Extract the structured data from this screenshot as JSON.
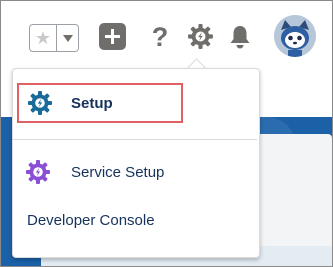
{
  "toolbar": {
    "favorites": {
      "star_icon": "star-icon",
      "caret_icon": "caret-down-icon"
    },
    "add_icon": "plus-icon",
    "help_label": "?",
    "setup_icon": "gear-icon",
    "notifications_icon": "bell-icon",
    "avatar_icon": "astro-avatar"
  },
  "menu": {
    "items": [
      {
        "label": "Setup",
        "icon": "gear-bolt-icon",
        "icon_color": "#1a6b9a",
        "highlighted": true
      },
      {
        "label": "Service Setup",
        "icon": "gear-bolt-icon",
        "icon_color": "#8a4fd6"
      },
      {
        "label": "Developer Console"
      }
    ]
  },
  "colors": {
    "highlight_border": "#e06064",
    "background_blue": "#1b61a8",
    "icon_gray": "#706e6b",
    "text_dark": "#16325c"
  }
}
